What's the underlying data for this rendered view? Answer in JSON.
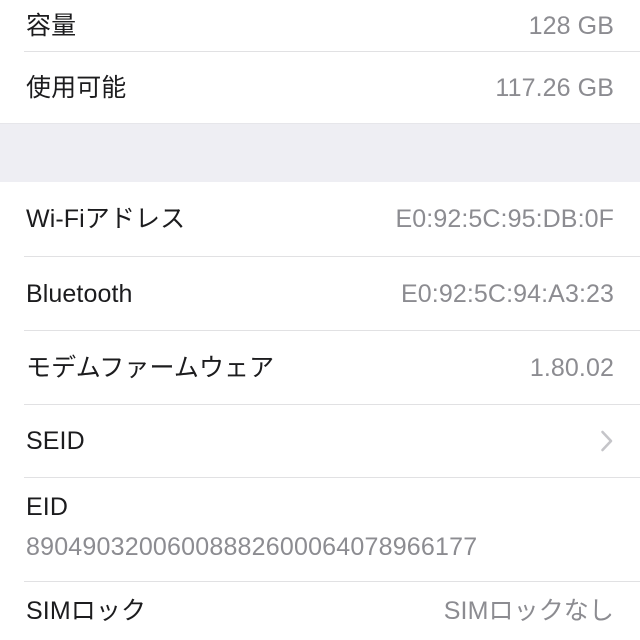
{
  "screen": {
    "name": "ios-settings-about",
    "background_color": "#FFFFFF",
    "label_color": "#1C1C1E",
    "value_color": "#8C8C91",
    "separator_color": "#E1E1E3",
    "group_gap_color": "#EEEEF3",
    "chevron_color": "#C5C5C9"
  },
  "sections": [
    {
      "id": "storage",
      "rows": [
        {
          "id": "capacity",
          "label": "容量",
          "value": "128 GB"
        },
        {
          "id": "available",
          "label": "使用可能",
          "value": "117.26 GB"
        }
      ]
    },
    {
      "id": "identifiers",
      "rows": [
        {
          "id": "wifi-address",
          "label": "Wi-Fiアドレス",
          "value": "E0:92:5C:95:DB:0F"
        },
        {
          "id": "bluetooth",
          "label": "Bluetooth",
          "value": "E0:92:5C:94:A3:23"
        },
        {
          "id": "modem-firmware",
          "label": "モデムファームウェア",
          "value": "1.80.02"
        },
        {
          "id": "seid",
          "label": "SEID",
          "value": "",
          "accessory": "chevron-right-icon"
        },
        {
          "id": "eid",
          "label": "EID",
          "value": "89049032006008882600064078966177",
          "stacked": true
        },
        {
          "id": "sim-lock",
          "label": "SIMロック",
          "value": "SIMロックなし"
        }
      ]
    }
  ]
}
